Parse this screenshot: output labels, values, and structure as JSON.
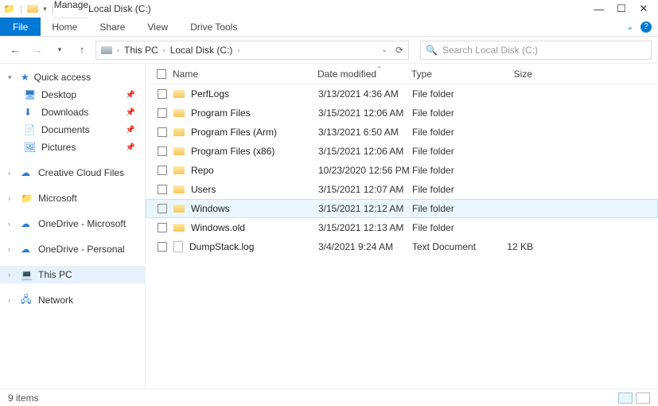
{
  "window": {
    "title": "Local Disk (C:)",
    "manage_label": "Manage",
    "drive_tools_label": "Drive Tools"
  },
  "ribbon": {
    "file": "File",
    "tabs": [
      "Home",
      "Share",
      "View"
    ]
  },
  "nav": {
    "breadcrumb_root": "This PC",
    "breadcrumb_current": "Local Disk (C:)",
    "search_placeholder": "Search Local Disk (C:)"
  },
  "sidebar": {
    "quick_access": "Quick access",
    "quick_items": [
      {
        "label": "Desktop",
        "icon": "desktop"
      },
      {
        "label": "Downloads",
        "icon": "downloads"
      },
      {
        "label": "Documents",
        "icon": "documents"
      },
      {
        "label": "Pictures",
        "icon": "pictures"
      }
    ],
    "groups": [
      {
        "label": "Creative Cloud Files",
        "icon": "ccf"
      },
      {
        "label": "Microsoft",
        "icon": "folder"
      },
      {
        "label": "OneDrive - Microsoft",
        "icon": "cloud"
      },
      {
        "label": "OneDrive - Personal",
        "icon": "cloud"
      },
      {
        "label": "This PC",
        "icon": "pc",
        "selected": true
      },
      {
        "label": "Network",
        "icon": "network"
      }
    ]
  },
  "columns": {
    "name": "Name",
    "date": "Date modified",
    "type": "Type",
    "size": "Size"
  },
  "rows": [
    {
      "name": "PerfLogs",
      "date": "3/13/2021 4:36 AM",
      "type": "File folder",
      "size": "",
      "icon": "folder"
    },
    {
      "name": "Program Files",
      "date": "3/15/2021 12:06 AM",
      "type": "File folder",
      "size": "",
      "icon": "folder"
    },
    {
      "name": "Program Files (Arm)",
      "date": "3/13/2021 6:50 AM",
      "type": "File folder",
      "size": "",
      "icon": "folder"
    },
    {
      "name": "Program Files (x86)",
      "date": "3/15/2021 12:06 AM",
      "type": "File folder",
      "size": "",
      "icon": "folder"
    },
    {
      "name": "Repo",
      "date": "10/23/2020 12:56 PM",
      "type": "File folder",
      "size": "",
      "icon": "folder"
    },
    {
      "name": "Users",
      "date": "3/15/2021 12:07 AM",
      "type": "File folder",
      "size": "",
      "icon": "folder"
    },
    {
      "name": "Windows",
      "date": "3/15/2021 12:12 AM",
      "type": "File folder",
      "size": "",
      "icon": "folder",
      "hover": true
    },
    {
      "name": "Windows.old",
      "date": "3/15/2021 12:13 AM",
      "type": "File folder",
      "size": "",
      "icon": "folder"
    },
    {
      "name": "DumpStack.log",
      "date": "3/4/2021 9:24 AM",
      "type": "Text Document",
      "size": "12 KB",
      "icon": "file"
    }
  ],
  "status": {
    "count_label": "9 items"
  }
}
